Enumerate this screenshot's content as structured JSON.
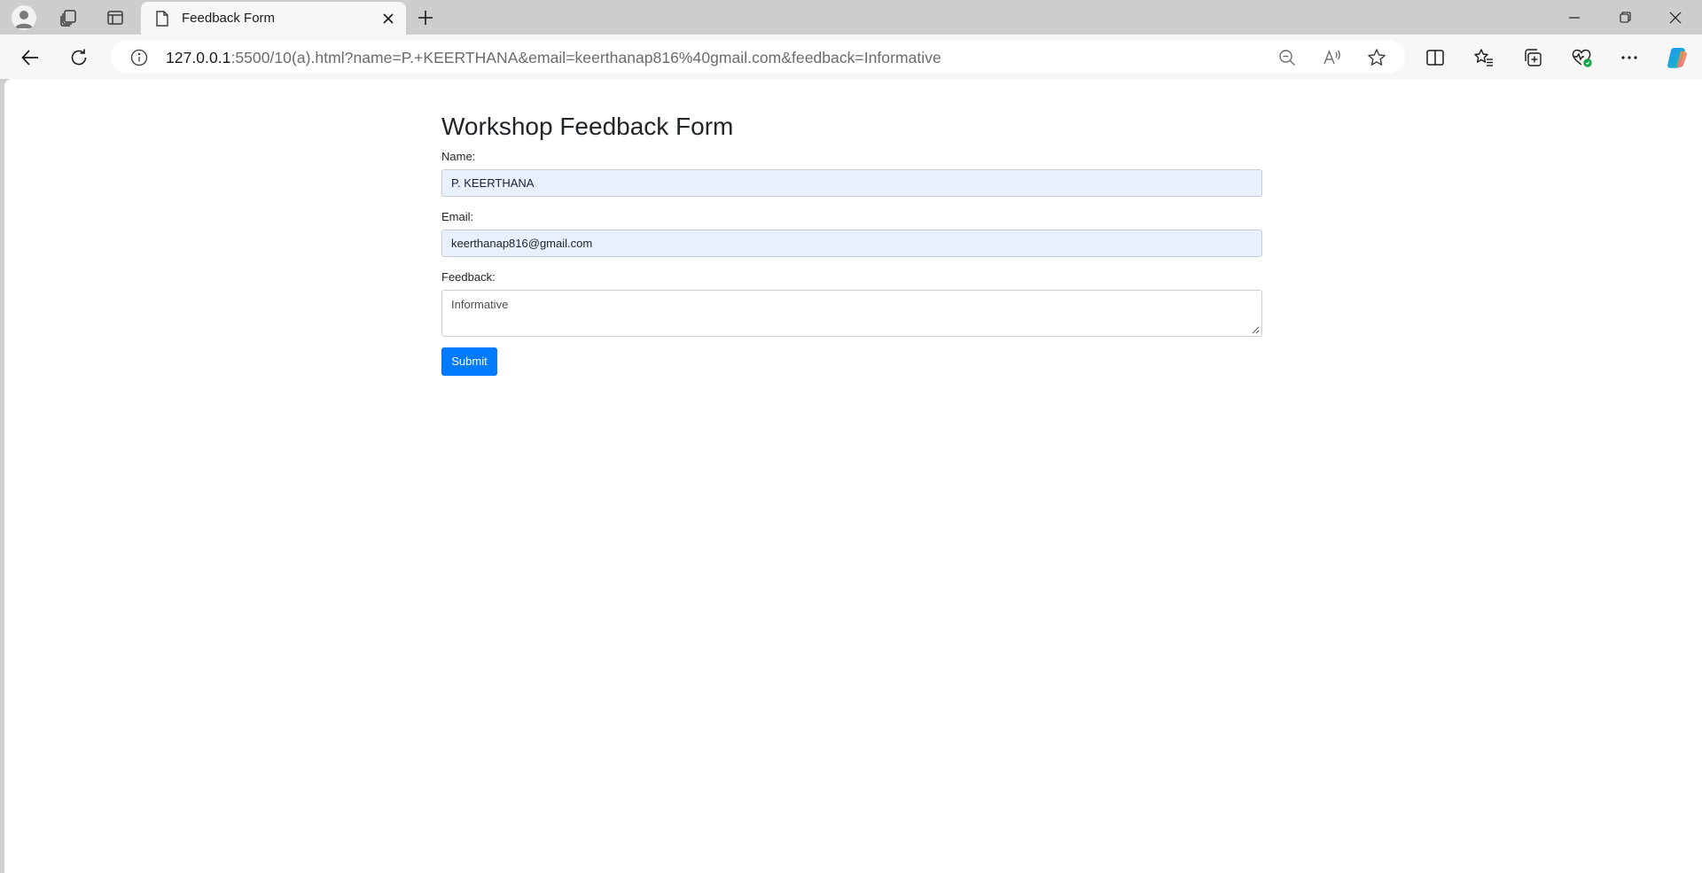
{
  "browser": {
    "tab": {
      "title": "Feedback Form"
    },
    "address_bar": {
      "url_host": "127.0.0.1",
      "url_rest": ":5500/10(a).html?name=P.+KEERTHANA&email=keerthanap816%40gmail.com&feedback=Informative"
    },
    "icons": {
      "profile": "profile-icon",
      "workspaces": "workspaces-icon",
      "tab_actions": "tab-actions-icon",
      "new_tab": "plus-icon",
      "back": "back-arrow-icon",
      "refresh": "refresh-icon",
      "site_info": "info-icon",
      "zoom": "zoom-out-icon",
      "read_aloud": "read-aloud-icon",
      "favorite": "star-icon",
      "split_screen": "split-screen-icon",
      "favorites": "favorites-icon",
      "collections": "collections-icon",
      "browser_essentials": "heart-pulse-icon",
      "more": "more-icon",
      "copilot": "copilot-icon"
    }
  },
  "form": {
    "heading": "Workshop Feedback Form",
    "name": {
      "label": "Name:",
      "value": "P. KEERTHANA"
    },
    "email": {
      "label": "Email:",
      "value": "keerthanap816@gmail.com"
    },
    "feedback": {
      "label": "Feedback:",
      "value": "Informative"
    },
    "submit_label": "Submit"
  },
  "colors": {
    "primary_button": "#007bff",
    "autofill_background": "#e8f0fe",
    "text": "#212529"
  }
}
